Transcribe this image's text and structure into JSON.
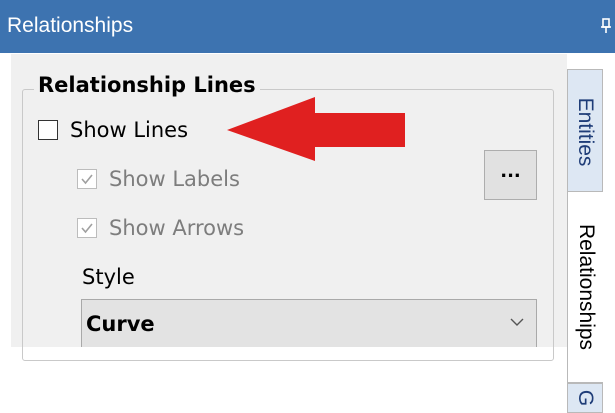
{
  "window": {
    "title": "Relationships",
    "pin_icon": "pin-icon"
  },
  "group": {
    "title": "Relationship Lines"
  },
  "checkboxes": [
    {
      "label": "Show Lines",
      "checked": false,
      "enabled": true
    },
    {
      "label": "Show Labels",
      "checked": true,
      "enabled": false
    },
    {
      "label": "Show Arrows",
      "checked": true,
      "enabled": false
    }
  ],
  "ellipsis_button": {
    "label": "..."
  },
  "style": {
    "label": "Style",
    "selected": "Curve",
    "dropdown_icon": "chevron-down-icon"
  },
  "annotation": {
    "arrow_color": "#e02020",
    "arrow_icon": "red-arrow-left"
  },
  "side_tabs": [
    {
      "label": "Entities",
      "active": false
    },
    {
      "label": "Relationships",
      "active": true
    },
    {
      "label": "G",
      "active": false
    }
  ],
  "colors": {
    "titlebar": "#3d73b0",
    "panel": "#f0f0f0",
    "tab_inactive": "#dde7f3"
  }
}
